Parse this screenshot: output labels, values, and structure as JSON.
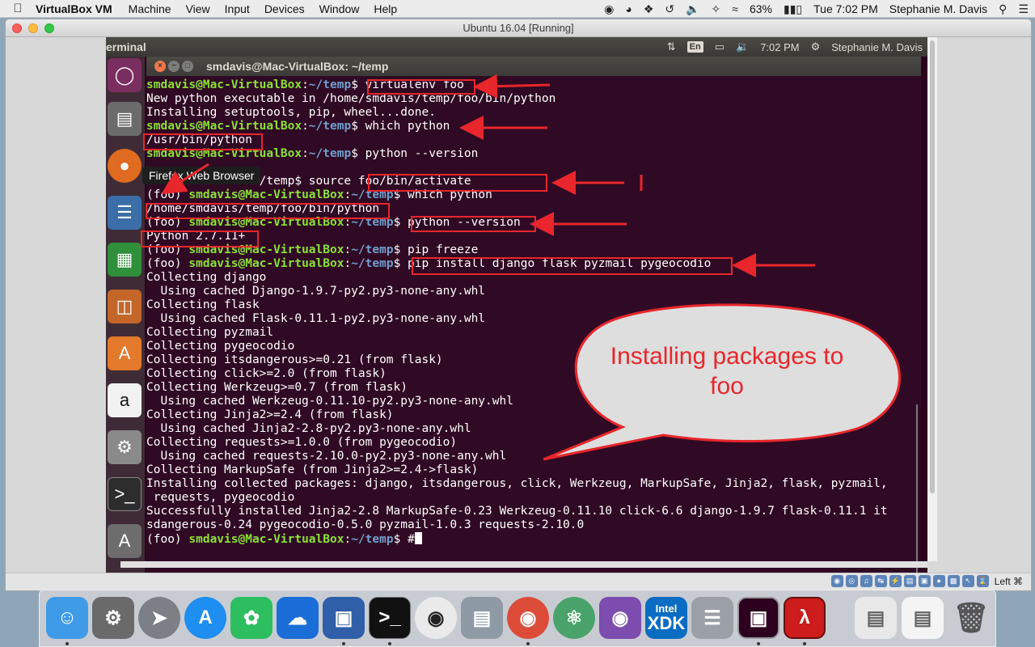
{
  "mac_menubar": {
    "app_name": "VirtualBox VM",
    "menus": [
      "Machine",
      "View",
      "Input",
      "Devices",
      "Window",
      "Help"
    ],
    "battery": "63%",
    "clock": "Tue 7:02 PM",
    "user": "Stephanie M. Davis"
  },
  "vbox": {
    "title": "Ubuntu 16.04 [Running]",
    "host_key": "Left ⌘"
  },
  "ubuntu_panel": {
    "app_title": "erminal",
    "lang": "En",
    "time": "7:02 PM",
    "user": "Stephanie M. Davis"
  },
  "tooltip": "Firefox Web Browser",
  "terminal": {
    "title": "smdavis@Mac-VirtualBox: ~/temp",
    "lines": [
      {
        "pre": "",
        "host": "smdavis@Mac-VirtualBox",
        "sep": ":",
        "path": "~/temp",
        "cmd": "$ virtualenv foo"
      },
      {
        "text": "New python executable in /home/smdavis/temp/foo/bin/python"
      },
      {
        "text": "Installing setuptools, pip, wheel...done."
      },
      {
        "pre": "",
        "host": "smdavis@Mac-VirtualBox",
        "sep": ":",
        "path": "~/temp",
        "cmd": "$ which python"
      },
      {
        "text": "/usr/bin/python"
      },
      {
        "pre": "",
        "host": "smdavis@Mac-VirtualBox",
        "sep": ":",
        "path": "~/temp",
        "cmd": "$ python --version"
      },
      {
        "text": ""
      },
      {
        "pre": "",
        "host": "",
        "sep": "",
        "path": "",
        "cmd": "              :~/temp$ source foo/bin/activate"
      },
      {
        "pre": "(foo) ",
        "host": "smdavis@Mac-VirtualBox",
        "sep": ":",
        "path": "~/temp",
        "cmd": "$ which python"
      },
      {
        "text": "/home/smdavis/temp/foo/bin/python"
      },
      {
        "pre": "(foo) ",
        "host": "smdavis@Mac-VirtualBox",
        "sep": ":",
        "path": "~/temp",
        "cmd": "$ python --version"
      },
      {
        "text": "Python 2.7.11+"
      },
      {
        "pre": "(foo) ",
        "host": "smdavis@Mac-VirtualBox",
        "sep": ":",
        "path": "~/temp",
        "cmd": "$ pip freeze"
      },
      {
        "pre": "(foo) ",
        "host": "smdavis@Mac-VirtualBox",
        "sep": ":",
        "path": "~/temp",
        "cmd": "$ pip install django flask pyzmail pygeocodio"
      },
      {
        "text": "Collecting django"
      },
      {
        "text": "  Using cached Django-1.9.7-py2.py3-none-any.whl"
      },
      {
        "text": "Collecting flask"
      },
      {
        "text": "  Using cached Flask-0.11.1-py2.py3-none-any.whl"
      },
      {
        "text": "Collecting pyzmail"
      },
      {
        "text": "Collecting pygeocodio"
      },
      {
        "text": "Collecting itsdangerous>=0.21 (from flask)"
      },
      {
        "text": "Collecting click>=2.0 (from flask)"
      },
      {
        "text": "Collecting Werkzeug>=0.7 (from flask)"
      },
      {
        "text": "  Using cached Werkzeug-0.11.10-py2.py3-none-any.whl"
      },
      {
        "text": "Collecting Jinja2>=2.4 (from flask)"
      },
      {
        "text": "  Using cached Jinja2-2.8-py2.py3-none-any.whl"
      },
      {
        "text": "Collecting requests>=1.0.0 (from pygeocodio)"
      },
      {
        "text": "  Using cached requests-2.10.0-py2.py3-none-any.whl"
      },
      {
        "text": "Collecting MarkupSafe (from Jinja2>=2.4->flask)"
      },
      {
        "text": "Installing collected packages: django, itsdangerous, click, Werkzeug, MarkupSafe, Jinja2, flask, pyzmail,"
      },
      {
        "text": " requests, pygeocodio"
      },
      {
        "text": "Successfully installed Jinja2-2.8 MarkupSafe-0.23 Werkzeug-0.11.10 click-6.6 django-1.9.7 flask-0.11.1 it"
      },
      {
        "text": "sdangerous-0.24 pygeocodio-0.5.0 pyzmail-1.0.3 requests-2.10.0"
      },
      {
        "pre": "(foo) ",
        "host": "smdavis@Mac-VirtualBox",
        "sep": ":",
        "path": "~/temp",
        "cmd": "$ #",
        "cursor": true
      }
    ]
  },
  "annotation": {
    "bubble_text": "Installing packages to foo",
    "color": "#e8262b"
  },
  "dock_apps": [
    "Finder",
    "System Preferences",
    "Launchpad",
    "App Store",
    "Evernote",
    "OpenOffice",
    "VirtualBox",
    "Terminal",
    "Sublime",
    "Utilities",
    "Chrome",
    "Atom",
    "GitHub",
    "Intel XDK",
    "Sequel",
    "Screenshot",
    "Acrobat"
  ],
  "dock_labels": {
    "xdk_top": "Intel",
    "xdk_bottom": "XDK"
  }
}
